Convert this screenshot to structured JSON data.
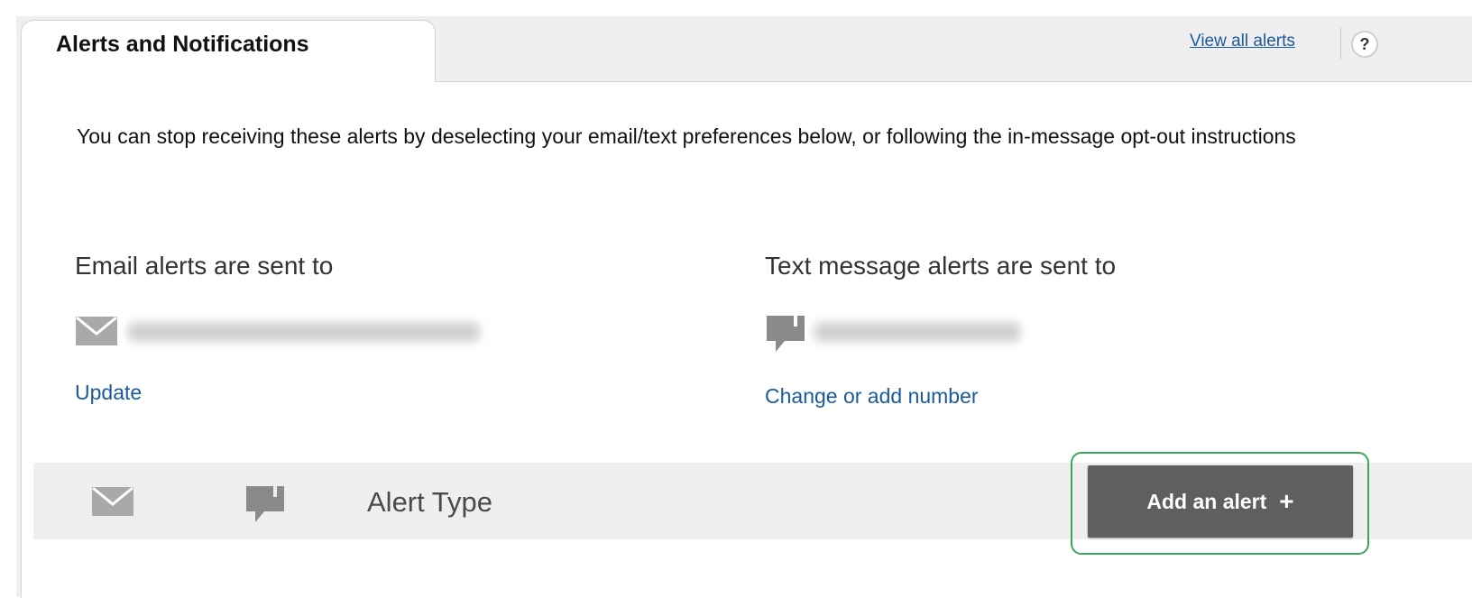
{
  "tab": {
    "title": "Alerts and Notifications"
  },
  "header_links": {
    "view_all": "View all alerts",
    "help": "?"
  },
  "description": "You can stop receiving these alerts by deselecting your email/text preferences below, or following the in-message opt-out instructions",
  "email": {
    "heading": "Email alerts are sent to",
    "icon": "envelope-icon",
    "link": "Update"
  },
  "text": {
    "heading": "Text message alerts are sent to",
    "icon": "speech-bubble-icon",
    "link": "Change or add number"
  },
  "table_header": {
    "email_icon": "envelope-icon",
    "text_icon": "speech-bubble-icon",
    "alert_type_label": "Alert Type",
    "add_button_label": "Add an alert",
    "add_button_icon": "+"
  },
  "colors": {
    "link": "#1a5a9c",
    "button_bg": "#5f5f5f",
    "highlight": "#3aa658",
    "panel_bg": "#efefef"
  }
}
